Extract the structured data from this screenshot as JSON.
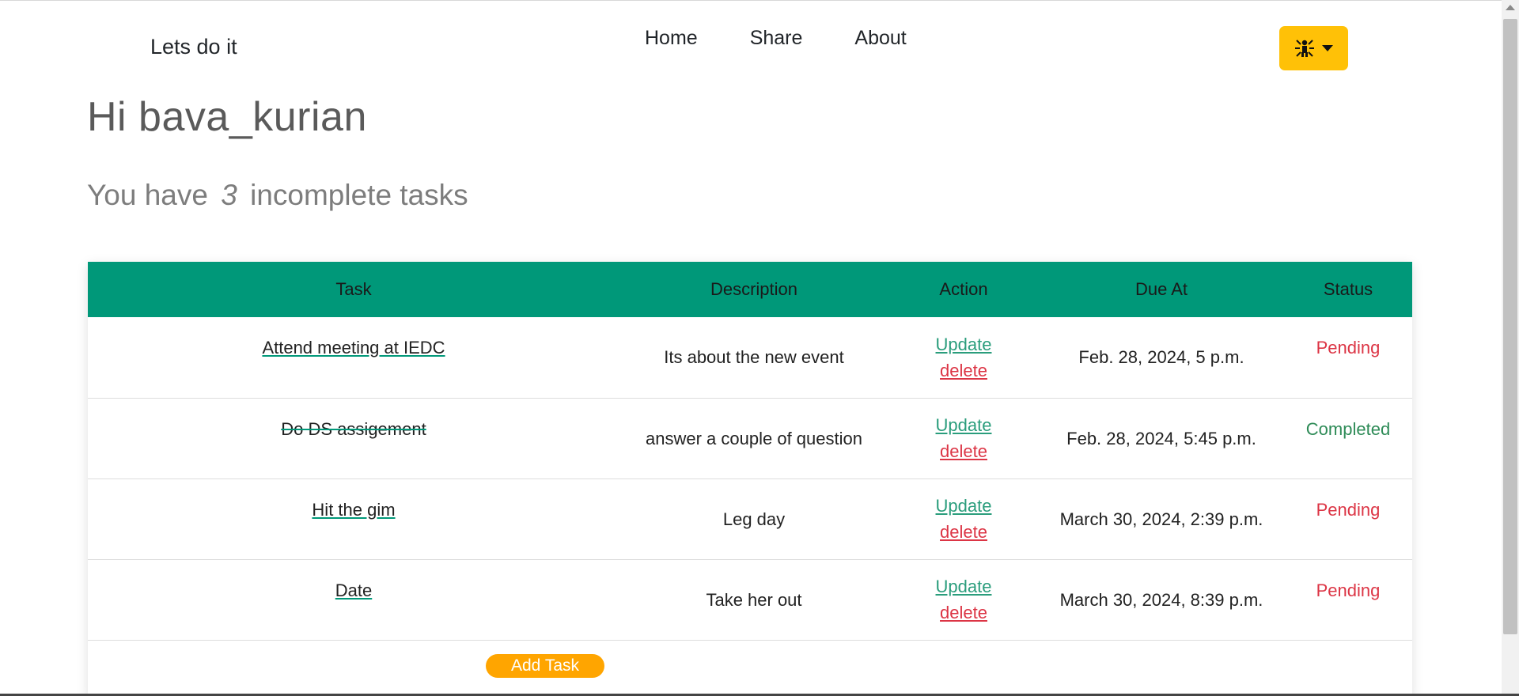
{
  "brand": "Lets do it",
  "nav": {
    "home": "Home",
    "share": "Share",
    "about": "About"
  },
  "theme_toggle": {
    "icon": "theme-auto-icon",
    "accent": "#ffc107"
  },
  "greeting": "Hi bava_kurian",
  "summary": {
    "prefix": "You have",
    "count": "3",
    "suffix": "incomplete tasks"
  },
  "table": {
    "header_color": "#009879",
    "columns": [
      "Task",
      "Description",
      "Action",
      "Due At",
      "Status"
    ],
    "rows": [
      {
        "task": "Attend meeting at IEDC",
        "description": "Its about the new event",
        "update": "Update",
        "delete": "delete",
        "due": "Feb. 28, 2024, 5 p.m.",
        "status": "Pending"
      },
      {
        "task": "Do DS assigement",
        "description": "answer a couple of question",
        "update": "Update",
        "delete": "delete",
        "due": "Feb. 28, 2024, 5:45 p.m.",
        "status": "Completed"
      },
      {
        "task": "Hit the gim",
        "description": "Leg day",
        "update": "Update",
        "delete": "delete",
        "due": "March 30, 2024, 2:39 p.m.",
        "status": "Pending"
      },
      {
        "task": "Date",
        "description": "Take her out",
        "update": "Update",
        "delete": "delete",
        "due": "March 30, 2024, 8:39 p.m.",
        "status": "Pending"
      }
    ]
  },
  "add_task_label": "Add Task",
  "add_task_color": "#ffa500"
}
